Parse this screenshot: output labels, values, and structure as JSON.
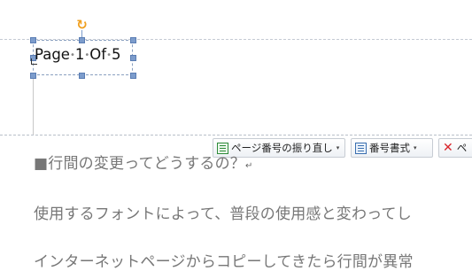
{
  "header_box": {
    "text_parts": [
      "Page",
      "1",
      "Of",
      "5"
    ],
    "space_marker": "•"
  },
  "toolbar": {
    "renumber_label": "ページ番号の振り直し",
    "format_label": "番号書式",
    "delete_label": "ペ",
    "caret": "▾"
  },
  "document": {
    "heading": "■行間の変更ってどうするの？",
    "paragraph_mark": "↵",
    "line2": "使用するフォントによって、普段の使用感と変わってし",
    "line3": "インターネットページからコピーしてきたら行間が異常"
  },
  "icons": {
    "rotate": "rotate-handle-icon",
    "renumber": "page-renumber-icon",
    "format": "number-format-icon",
    "delete": "delete-x-icon"
  },
  "colors": {
    "rotate_handle": "#f0a020",
    "selection_handle": "#7c9ccc",
    "delete_icon": "#d9242a",
    "body_text": "#777777"
  }
}
